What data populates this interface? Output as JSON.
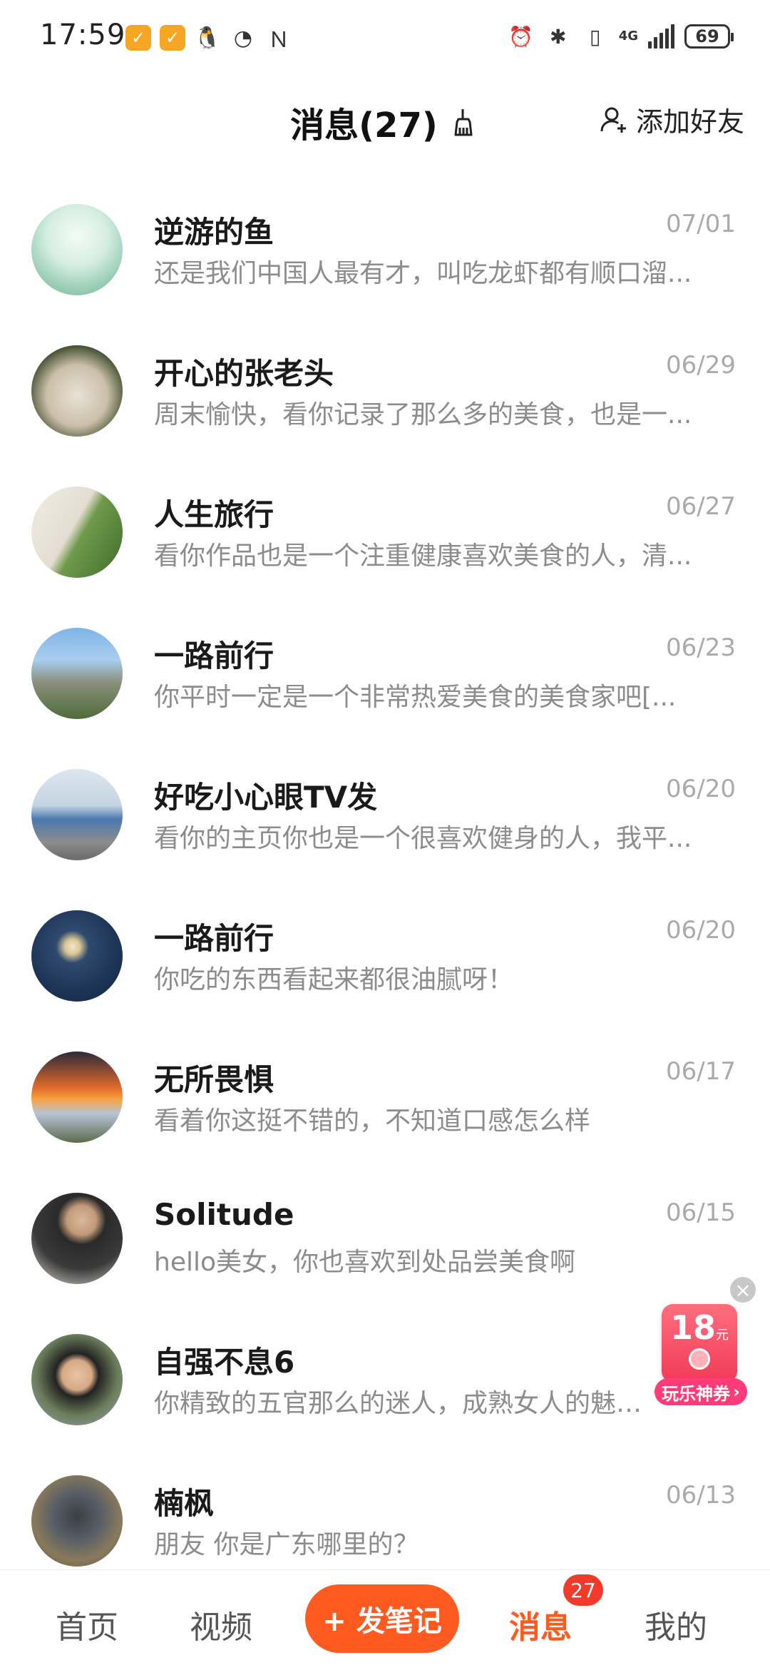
{
  "status_bar": {
    "time": "17:59",
    "battery": "69",
    "network": "4G"
  },
  "header": {
    "title": "消息(27)",
    "add_friend": "添加好友"
  },
  "messages": [
    {
      "name": "逆游的鱼",
      "date": "07/01",
      "preview": "还是我们中国人最有才，叫吃龙虾都有顺口溜..."
    },
    {
      "name": "开心的张老头",
      "date": "06/29",
      "preview": "周末愉快，看你记录了那么多的美食，也是一..."
    },
    {
      "name": "人生旅行",
      "date": "06/27",
      "preview": "看你作品也是一个注重健康喜欢美食的人，清..."
    },
    {
      "name": "一路前行",
      "date": "06/23",
      "preview": "你平时一定是一个非常热爱美食的美食家吧[..."
    },
    {
      "name": "好吃小心眼TV发",
      "date": "06/20",
      "preview": "看你的主页你也是一个很喜欢健身的人，我平..."
    },
    {
      "name": "一路前行",
      "date": "06/20",
      "preview": "你吃的东西看起来都很油腻呀！"
    },
    {
      "name": "无所畏惧",
      "date": "06/17",
      "preview": "看着你这挺不错的，不知道口感怎么样"
    },
    {
      "name": "Solitude",
      "date": "06/15",
      "preview": "hello美女，你也喜欢到处品尝美食啊"
    },
    {
      "name": "自强不息6",
      "date": "",
      "preview": "你精致的五官那么的迷人，成熟女人的魅力..."
    },
    {
      "name": "楠枫",
      "date": "06/13",
      "preview": "朋友 你是广东哪里的？"
    }
  ],
  "coupon": {
    "amount": "18",
    "unit": "元",
    "label": "玩乐神券",
    "arrow": "›",
    "close": "×"
  },
  "bottom_nav": {
    "home": "首页",
    "video": "视频",
    "post": "+ 发笔记",
    "messages": "消息",
    "messages_badge": "27",
    "mine": "我的"
  }
}
